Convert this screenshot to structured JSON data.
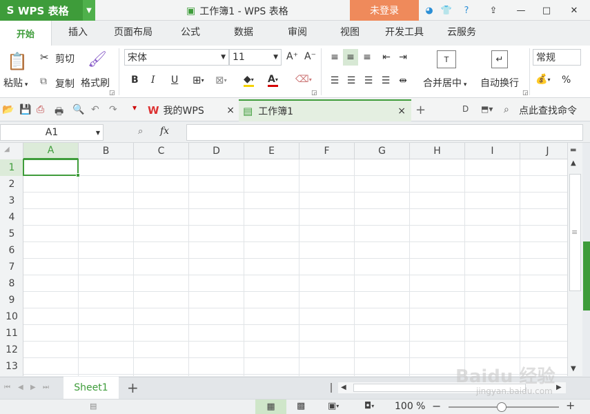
{
  "app": {
    "logo_glyph": "S",
    "name": "WPS 表格",
    "window_title": "工作簿1 - WPS 表格",
    "login_label": "未登录"
  },
  "ribbon_tabs": [
    "开始",
    "插入",
    "页面布局",
    "公式",
    "数据",
    "审阅",
    "视图",
    "开发工具",
    "云服务"
  ],
  "clipboard": {
    "paste": "粘贴",
    "cut": "剪切",
    "copy": "复制",
    "format_painter": "格式刷"
  },
  "font": {
    "name": "宋体",
    "size": "11",
    "bold": "B",
    "italic": "I",
    "underline": "U"
  },
  "alignment": {
    "merge_center": "合并居中",
    "wrap_text": "自动换行"
  },
  "number": {
    "format": "常规",
    "percent": "%"
  },
  "doc_tabs": [
    {
      "label": "我的WPS",
      "close": "×"
    },
    {
      "label": "工作簿1",
      "close": "×"
    }
  ],
  "search_command": "点此查找命令",
  "formula_bar": {
    "name_box": "A1",
    "fx": "fx",
    "value": ""
  },
  "columns": [
    "A",
    "B",
    "C",
    "D",
    "E",
    "F",
    "G",
    "H",
    "I",
    "J"
  ],
  "rows": [
    "1",
    "2",
    "3",
    "4",
    "5",
    "6",
    "7",
    "8",
    "9",
    "10",
    "11",
    "12",
    "13"
  ],
  "sheets": [
    {
      "name": "Sheet1",
      "active": true
    }
  ],
  "add_sheet": "+",
  "status": {
    "zoom": "100 %",
    "zoom_level_percent": 100
  },
  "watermark": {
    "text": "Baidu 经验",
    "url": "jingyan.baidu.com"
  },
  "colors": {
    "accent": "#3e9c3a",
    "login": "#ef8a5b"
  }
}
